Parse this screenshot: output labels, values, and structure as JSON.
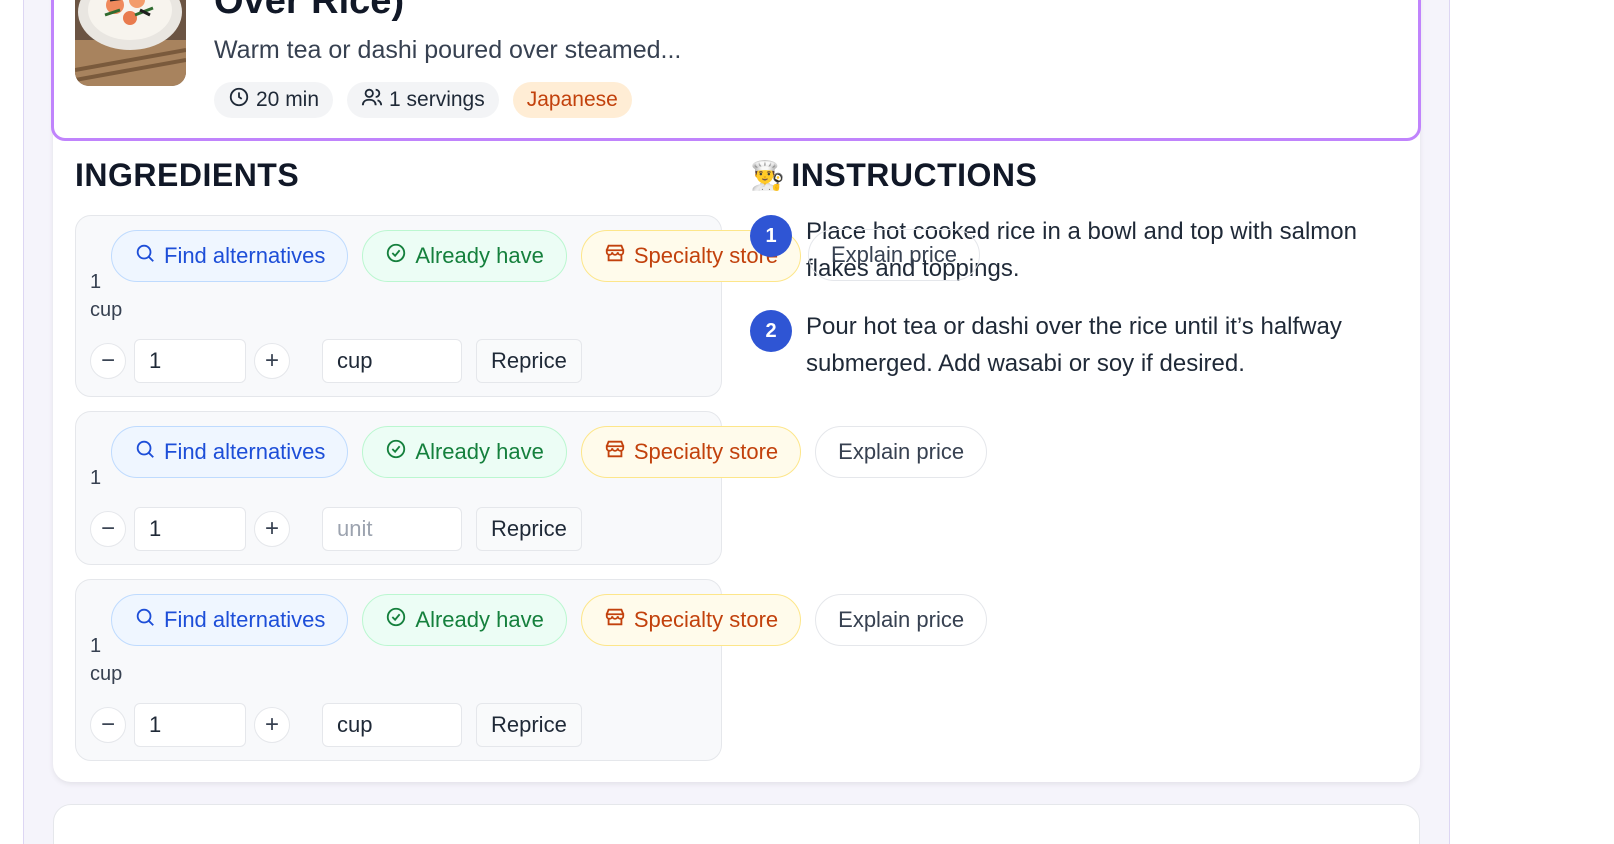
{
  "recipe": {
    "title": "Over Rice)",
    "description": "Warm tea or dashi poured over steamed...",
    "time": "20 min",
    "servings": "1 servings",
    "cuisine": "Japanese"
  },
  "ingredients_section": {
    "title": "INGREDIENTS"
  },
  "instructions_section": {
    "icon": "chef-emoji",
    "emoji": "👨‍🍳",
    "title": "INSTRUCTIONS"
  },
  "actions": {
    "find": "Find alternatives",
    "have": "Already have",
    "store": "Specialty store",
    "explain": "Explain price",
    "reprice": "Reprice"
  },
  "ingredients": [
    {
      "qty": "1",
      "unit_label": "cup",
      "amount": "1",
      "unit": "cup",
      "unit_placeholder": "unit"
    },
    {
      "qty": "1",
      "unit_label": "",
      "amount": "1",
      "unit": "",
      "unit_placeholder": "unit"
    },
    {
      "qty": "1",
      "unit_label": "cup",
      "amount": "1",
      "unit": "cup",
      "unit_placeholder": "unit"
    }
  ],
  "instructions": [
    {
      "number": "1",
      "text": "Place hot cooked rice in a bowl and top with salmon flakes and toppings."
    },
    {
      "number": "2",
      "text": "Pour hot tea or dashi over the rice until it’s halfway submerged. Add wasabi or soy if desired."
    }
  ],
  "colors": {
    "accent_border": "#c084fc",
    "step_badge": "#2f55d4",
    "find": "#1d4ed8",
    "have": "#15803d",
    "store": "#c2410c"
  }
}
